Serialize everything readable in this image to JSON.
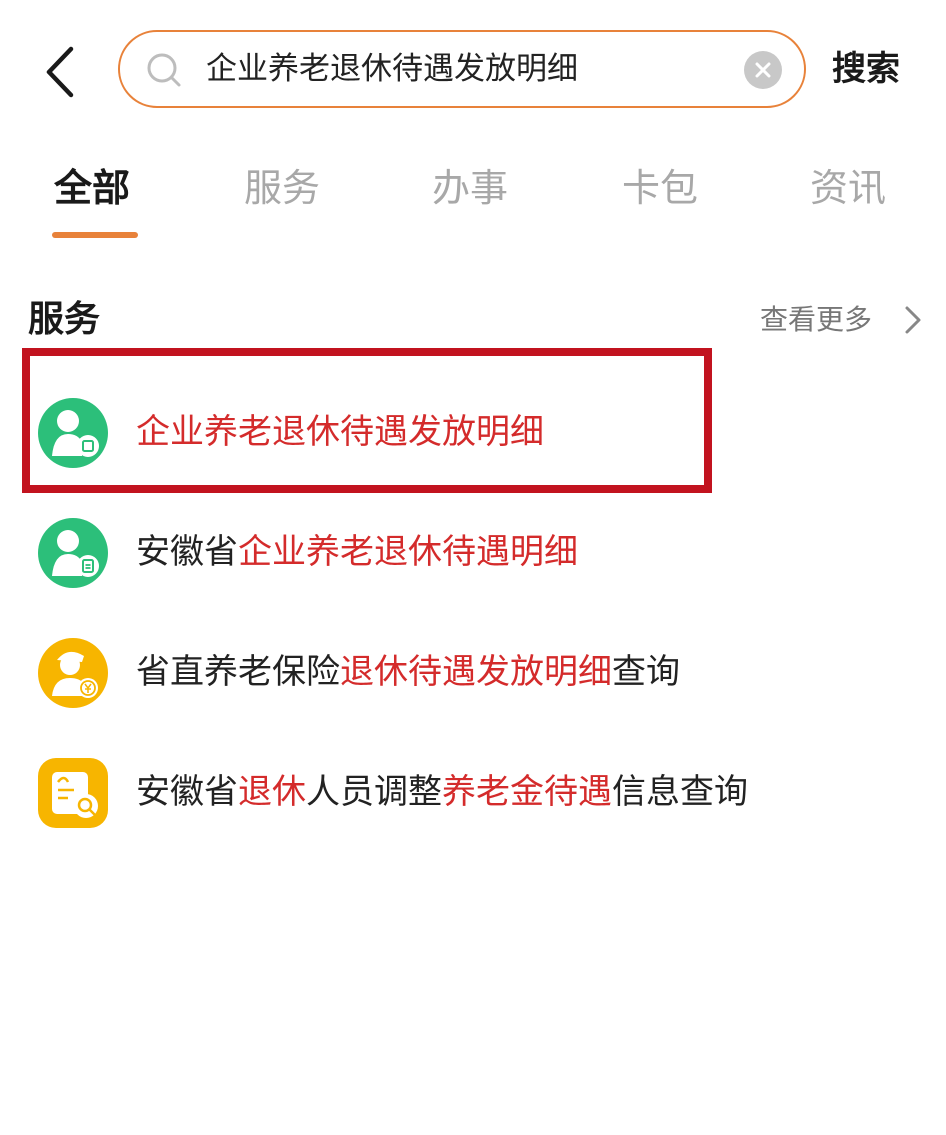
{
  "search": {
    "query": "企业养老退休待遇发放明细",
    "button_label": "搜索"
  },
  "tabs": [
    {
      "label": "全部",
      "active": true
    },
    {
      "label": "服务",
      "active": false
    },
    {
      "label": "办事",
      "active": false
    },
    {
      "label": "卡包",
      "active": false
    },
    {
      "label": "资讯",
      "active": false
    }
  ],
  "section": {
    "title": "服务",
    "see_more": "查看更多"
  },
  "results": [
    {
      "icon": "pension-detail-icon",
      "icon_color": "#2cbf7a",
      "parts": [
        {
          "text": "企业养老退休待遇发放明细",
          "highlight": true
        }
      ]
    },
    {
      "icon": "pension-list-icon",
      "icon_color": "#2cbf7a",
      "parts": [
        {
          "text": "安徽省",
          "highlight": false
        },
        {
          "text": "企业养老退休待遇明细",
          "highlight": true
        }
      ]
    },
    {
      "icon": "pension-money-icon",
      "icon_color": "#f7b500",
      "parts": [
        {
          "text": "省直养老保险",
          "highlight": false
        },
        {
          "text": "退休待遇发放明细",
          "highlight": true
        },
        {
          "text": "查询",
          "highlight": false
        }
      ]
    },
    {
      "icon": "document-search-icon",
      "icon_color": "#f7b500",
      "parts": [
        {
          "text": "安徽省",
          "highlight": false
        },
        {
          "text": "退休",
          "highlight": true
        },
        {
          "text": "人员调整",
          "highlight": false
        },
        {
          "text": "养老金待遇",
          "highlight": true
        },
        {
          "text": "信息查询",
          "highlight": false
        }
      ]
    }
  ],
  "colors": {
    "accent": "#e8823a",
    "highlight_text": "#d42b2b",
    "annotation_frame": "#c2131f"
  }
}
